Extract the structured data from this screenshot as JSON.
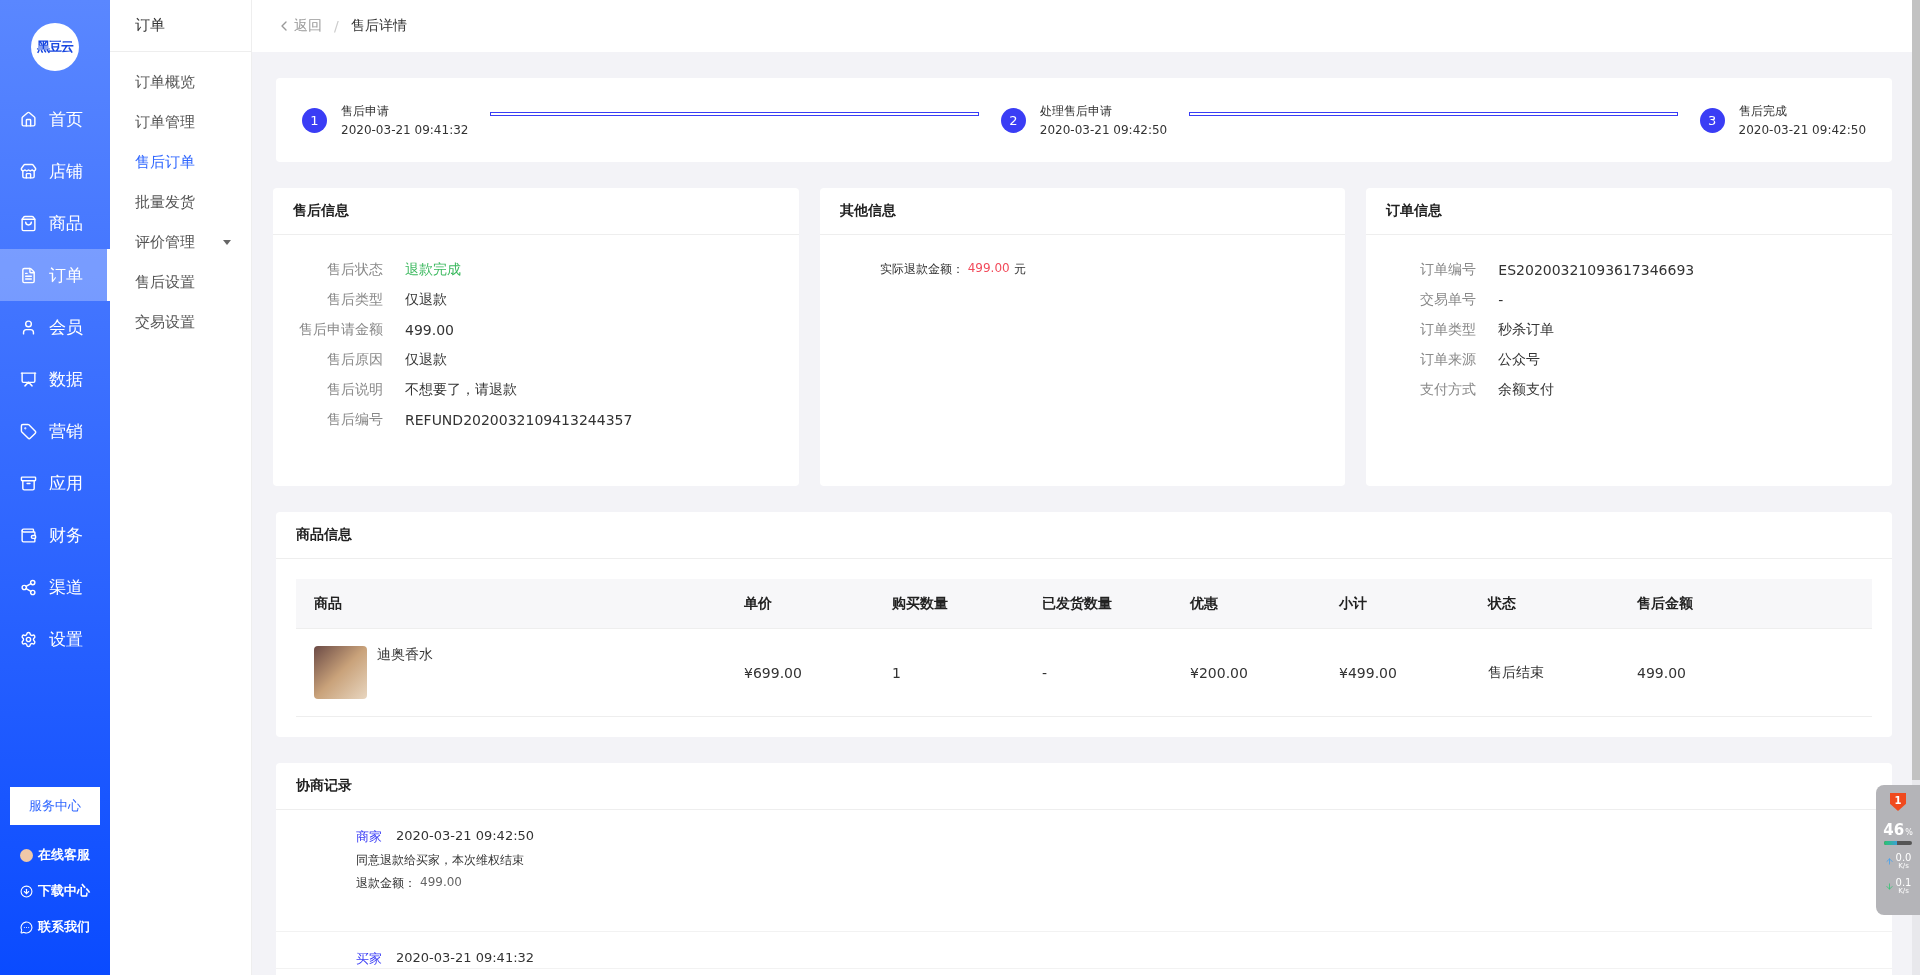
{
  "sidebar": {
    "logo": "黑豆云",
    "items": [
      {
        "label": "首页",
        "selected": false
      },
      {
        "label": "店铺",
        "selected": false
      },
      {
        "label": "商品",
        "selected": false
      },
      {
        "label": "订单",
        "selected": true
      },
      {
        "label": "会员",
        "selected": false
      },
      {
        "label": "数据",
        "selected": false
      },
      {
        "label": "营销",
        "selected": false
      },
      {
        "label": "应用",
        "selected": false
      },
      {
        "label": "财务",
        "selected": false
      },
      {
        "label": "渠道",
        "selected": false
      },
      {
        "label": "设置",
        "selected": false
      }
    ],
    "service_button": "服务中心",
    "links": [
      {
        "label": "在线客服"
      },
      {
        "label": "下载中心"
      },
      {
        "label": "联系我们"
      }
    ]
  },
  "submenu": {
    "title": "订单",
    "items": [
      {
        "label": "订单概览",
        "kind": "link",
        "selected": false
      },
      {
        "label": "订单管理",
        "kind": "link",
        "selected": false
      },
      {
        "label": "售后订单",
        "kind": "link",
        "selected": true
      },
      {
        "label": "批量发货",
        "kind": "link",
        "selected": false
      },
      {
        "label": "评价管理",
        "kind": "group",
        "selected": false
      },
      {
        "label": "售后设置",
        "kind": "link",
        "selected": false
      },
      {
        "label": "交易设置",
        "kind": "link",
        "selected": false
      }
    ]
  },
  "breadcrumb": {
    "back": "返回",
    "separator": "/",
    "current": "售后详情"
  },
  "steps": [
    {
      "number": "1",
      "title": "售后申请",
      "time": "2020-03-21 09:41:32"
    },
    {
      "number": "2",
      "title": "处理售后申请",
      "time": "2020-03-21 09:42:50"
    },
    {
      "number": "3",
      "title": "售后完成",
      "time": "2020-03-21 09:42:50"
    }
  ],
  "after_sale_info": {
    "title": "售后信息",
    "fields": [
      {
        "label": "售后状态",
        "value": "退款完成",
        "color": "#3cb95f"
      },
      {
        "label": "售后类型",
        "value": "仅退款"
      },
      {
        "label": "售后申请金额",
        "value": "499.00"
      },
      {
        "label": "售后原因",
        "value": "仅退款"
      },
      {
        "label": "售后说明",
        "value": "不想要了，请退款"
      },
      {
        "label": "售后编号",
        "value": "REFUND2020032109413244357"
      }
    ]
  },
  "other_info": {
    "title": "其他信息",
    "refund_label": "实际退款金额：",
    "refund_amount": "499.00",
    "unit": "元"
  },
  "order_info": {
    "title": "订单信息",
    "fields": [
      {
        "label": "订单编号",
        "value": "ES20200321093617346693"
      },
      {
        "label": "交易单号",
        "value": "-"
      },
      {
        "label": "订单类型",
        "value": "秒杀订单"
      },
      {
        "label": "订单来源",
        "value": "公众号"
      },
      {
        "label": "支付方式",
        "value": "余额支付"
      }
    ]
  },
  "products": {
    "title": "商品信息",
    "columns": [
      "商品",
      "单价",
      "购买数量",
      "已发货数量",
      "优惠",
      "小计",
      "状态",
      "售后金额"
    ],
    "rows": [
      {
        "name": "迪奥香水",
        "price": "¥699.00",
        "quantity": "1",
        "shipped": "-",
        "discount": "¥200.00",
        "subtotal": "¥499.00",
        "status": "售后结束",
        "refund": "499.00"
      }
    ]
  },
  "records": {
    "title": "协商记录",
    "entries": [
      {
        "role": "商家",
        "time": "2020-03-21 09:42:50",
        "message": "同意退款给买家，本次维权结束",
        "amount_label": "退款金额：",
        "amount": "499.00"
      },
      {
        "role": "买家",
        "time": "2020-03-21 09:41:32"
      }
    ]
  },
  "monitor": {
    "badge": "1",
    "percent": "46",
    "unit": "%",
    "level": 0.46,
    "upload": "0.0",
    "upload_unit": "K/s",
    "download": "0.1",
    "download_unit": "K/s"
  }
}
